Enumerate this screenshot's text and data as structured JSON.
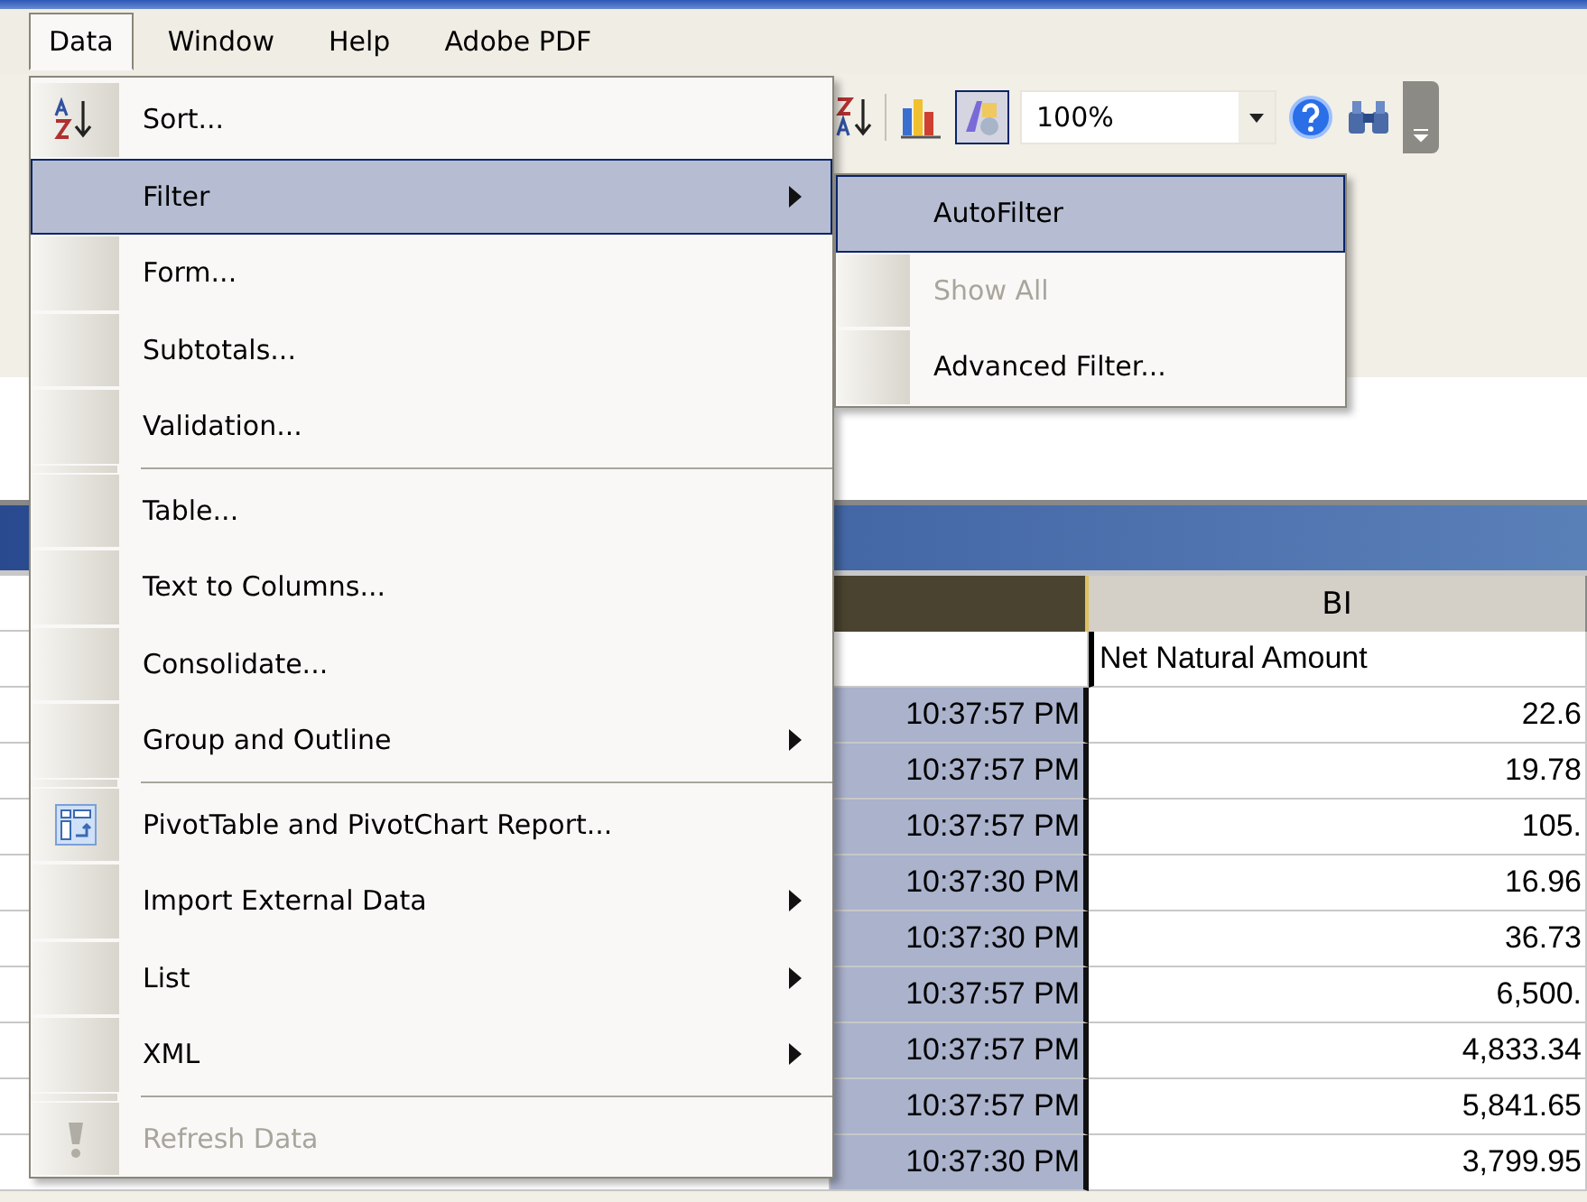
{
  "menubar": [
    {
      "label": "Data",
      "open": true
    },
    {
      "label": "Window",
      "open": false
    },
    {
      "label": "Help",
      "open": false
    },
    {
      "label": "Adobe PDF",
      "open": false
    }
  ],
  "toolbar": {
    "zoom": "100%"
  },
  "data_menu": [
    {
      "kind": "command",
      "label": "Sort...",
      "selected": false,
      "disabled": false
    },
    {
      "kind": "submenu",
      "label": "Filter",
      "selected": true,
      "disabled": false
    },
    {
      "kind": "command",
      "label": "Form...",
      "selected": false,
      "disabled": false
    },
    {
      "kind": "command",
      "label": "Subtotals...",
      "selected": false,
      "disabled": false
    },
    {
      "kind": "command",
      "label": "Validation...",
      "selected": false,
      "disabled": false
    },
    {
      "kind": "separator"
    },
    {
      "kind": "command",
      "label": "Table...",
      "selected": false,
      "disabled": false
    },
    {
      "kind": "command",
      "label": "Text to Columns...",
      "selected": false,
      "disabled": false
    },
    {
      "kind": "command",
      "label": "Consolidate...",
      "selected": false,
      "disabled": false
    },
    {
      "kind": "submenu",
      "label": "Group and Outline",
      "selected": false,
      "disabled": false
    },
    {
      "kind": "separator"
    },
    {
      "kind": "command",
      "label": "PivotTable and PivotChart Report...",
      "selected": false,
      "disabled": false
    },
    {
      "kind": "submenu",
      "label": "Import External Data",
      "selected": false,
      "disabled": false
    },
    {
      "kind": "submenu",
      "label": "List",
      "selected": false,
      "disabled": false
    },
    {
      "kind": "submenu",
      "label": "XML",
      "selected": false,
      "disabled": false
    },
    {
      "kind": "separator"
    },
    {
      "kind": "command",
      "label": "Refresh Data",
      "selected": false,
      "disabled": true
    }
  ],
  "filter_submenu": [
    {
      "label": "AutoFilter",
      "selected": true,
      "disabled": false
    },
    {
      "label": "Show All",
      "selected": false,
      "disabled": true
    },
    {
      "label": "Advanced Filter...",
      "selected": false,
      "disabled": false
    }
  ],
  "sheet": {
    "columns": [
      {
        "selected": true
      },
      {
        "label": "BI",
        "selected": false
      }
    ],
    "header_row": {
      "column_2": "Net Natural Amount"
    },
    "rows": [
      {
        "column_1": "10:37:57 PM",
        "column_2": "22.6"
      },
      {
        "column_1": "10:37:57 PM",
        "column_2": "19.78"
      },
      {
        "column_1": "10:37:57 PM",
        "column_2": "105."
      },
      {
        "column_1": "10:37:30 PM",
        "column_2": "16.96"
      },
      {
        "column_1": "10:37:30 PM",
        "column_2": "36.73"
      },
      {
        "column_1": "10:37:57 PM",
        "column_2": "6,500."
      },
      {
        "column_1": "10:37:57 PM",
        "column_2": "4,833.34"
      },
      {
        "column_1": "10:37:57 PM",
        "column_2": "5,841.65"
      },
      {
        "column_1": "10:37:30 PM",
        "column_2": "3,799.95"
      }
    ]
  }
}
